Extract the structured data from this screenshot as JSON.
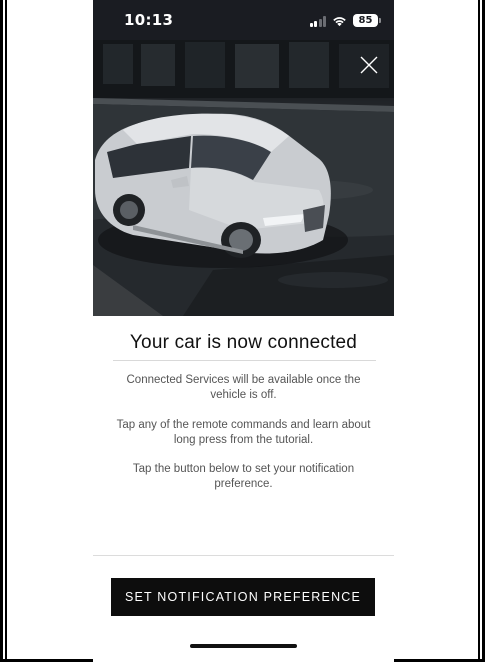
{
  "status_bar": {
    "time": "10:13",
    "battery": "85"
  },
  "hero": {
    "image_icon": "car-photo",
    "close_icon": "close-icon"
  },
  "content": {
    "title": "Your car is now connected",
    "paragraph_1": "Connected Services will be available once the vehicle is off.",
    "paragraph_2": "Tap any of the remote commands and learn about long press from the tutorial.",
    "paragraph_3": "Tap the button below to set your notification preference."
  },
  "actions": {
    "cta_label": "SET NOTIFICATION PREFERENCE"
  },
  "colors": {
    "status_bar_bg": "#1a1c22",
    "button_bg": "#0d0d0d",
    "text_primary": "#111111",
    "text_secondary": "#555555"
  }
}
